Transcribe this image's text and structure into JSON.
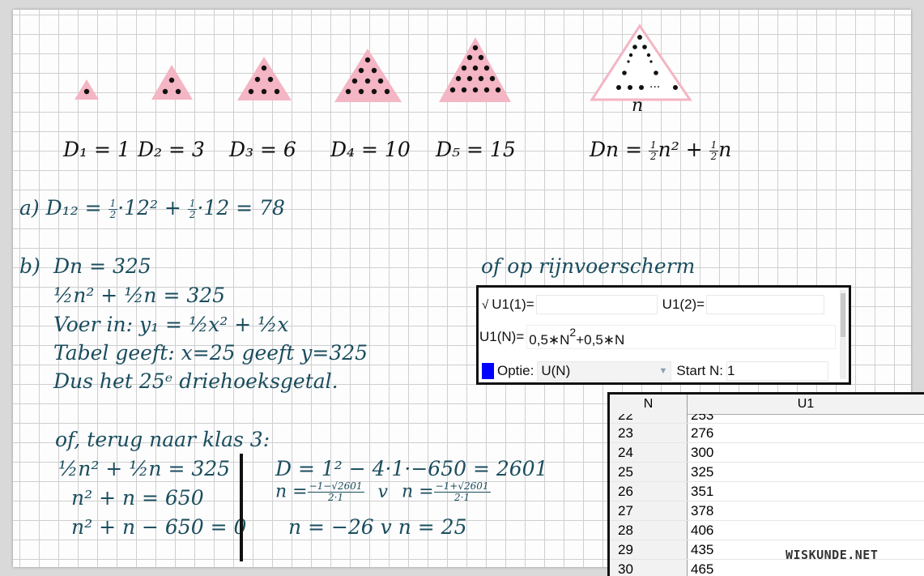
{
  "triangles": {
    "n_label": "n",
    "dots_label": "...",
    "formulas": [
      {
        "label": "D₁ = 1"
      },
      {
        "label": "D₂ = 3"
      },
      {
        "label": "D₃ = 6"
      },
      {
        "label": "D₄ = 10"
      },
      {
        "label": "D₅ = 15"
      }
    ],
    "general": {
      "prefix": "Dn = ",
      "half": "1",
      "two": "2",
      "mid": "n² + ",
      "end": "n"
    }
  },
  "part_a": {
    "label": "a)",
    "text_start": "D₁₂ = ",
    "text_mid": "·12² + ",
    "text_end": "·12 = 78",
    "half_num": "1",
    "half_den": "2"
  },
  "part_b": {
    "label": "b)",
    "line1": "Dn = 325",
    "line2": "½n² + ½n = 325",
    "line3": "Voer in: y₁ = ½x² + ½x",
    "line4": "Tabel geeft: x=25 geeft y=325",
    "line5": "Dus het 25ᵉ driehoeksgetal."
  },
  "alternative": {
    "header": "of, terug naar klas 3:",
    "left": [
      "½n² + ½n = 325",
      "n² + n = 650",
      "n² + n − 650 = 0"
    ],
    "right_line1": "D = 1² − 4·1·−650 = 2601",
    "n_eq": "n =",
    "frac1_num": "−1−√2601",
    "frac2_num": "−1+√2601",
    "frac_den": "2·1",
    "v": "v",
    "result": "n = −26   v   n = 25"
  },
  "screen_note": "of op rijnvoerscherm",
  "calculator": {
    "check": "√",
    "u1_1_label": "U1(1)=",
    "u1_2_label": "U1(2)=",
    "u1_n_label": "U1(N)=",
    "expr_a": "0,5∗N",
    "expr_sup": "2",
    "expr_b": "+0,5∗N",
    "option_label": "Optie:",
    "option_value": "U(N)",
    "start_label": "Start N:",
    "start_value": "1",
    "option_color": "#0000ff"
  },
  "table": {
    "headers": [
      "N",
      "U1"
    ],
    "partial_top": "22 / 253",
    "rows": [
      {
        "n": "23",
        "u": "276"
      },
      {
        "n": "24",
        "u": "300"
      },
      {
        "n": "25",
        "u": "325"
      },
      {
        "n": "26",
        "u": "351"
      },
      {
        "n": "27",
        "u": "378"
      },
      {
        "n": "28",
        "u": "406"
      },
      {
        "n": "29",
        "u": "435"
      },
      {
        "n": "30",
        "u": "465"
      }
    ]
  },
  "watermark": "WISKUNDE.NET",
  "colors": {
    "pink": "#f4b5c4",
    "ink": "#111111",
    "teal": "#1a4d5e"
  }
}
